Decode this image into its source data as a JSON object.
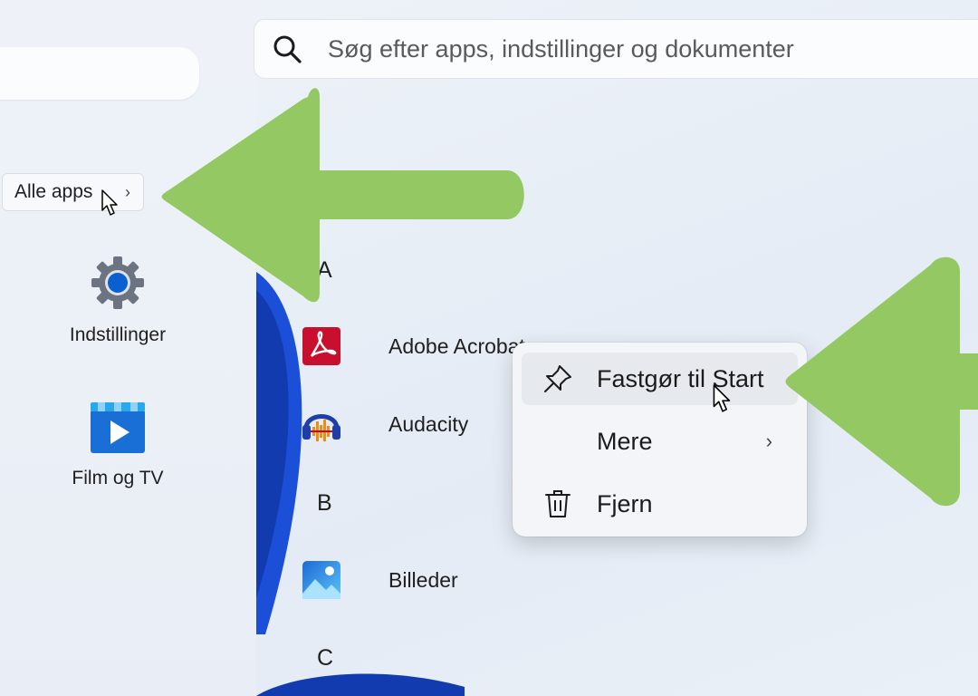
{
  "left_menu": {
    "all_apps_label": "Alle apps",
    "pinned": [
      {
        "label": "Indstillinger",
        "icon": "settings-gear-icon"
      },
      {
        "label": "Film og TV",
        "icon": "film-tv-icon"
      }
    ]
  },
  "start_menu": {
    "search_placeholder": "Søg efter apps, indstillinger og dokumenter",
    "groups": [
      {
        "letter": "A",
        "apps": [
          {
            "name": "Adobe Acrobat",
            "icon": "adobe-acrobat-icon"
          },
          {
            "name": "Audacity",
            "icon": "audacity-icon"
          }
        ]
      },
      {
        "letter": "B",
        "apps": [
          {
            "name": "Billeder",
            "icon": "photos-icon"
          }
        ]
      },
      {
        "letter": "C",
        "apps": []
      }
    ]
  },
  "context_menu": {
    "items": [
      {
        "label": "Fastgør til Start",
        "icon": "pin-icon"
      },
      {
        "label": "Mere",
        "icon": "",
        "has_submenu": true
      },
      {
        "label": "Fjern",
        "icon": "trash-icon"
      }
    ]
  },
  "annotations": {
    "arrow_color": "#93c862"
  },
  "colors": {
    "accent_blue": "#0a5fd1",
    "acrobat_red": "#c8102e"
  }
}
